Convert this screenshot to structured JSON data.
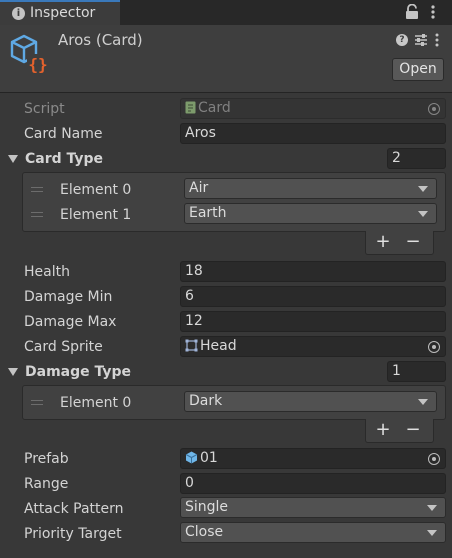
{
  "window": {
    "tab_label": "Inspector",
    "title": "Aros (Card)",
    "open_label": "Open"
  },
  "fields": {
    "script": {
      "label": "Script",
      "value": "Card"
    },
    "card_name": {
      "label": "Card Name",
      "value": "Aros"
    },
    "card_type": {
      "label": "Card Type",
      "count": "2",
      "elements": [
        {
          "label": "Element 0",
          "value": "Air"
        },
        {
          "label": "Element 1",
          "value": "Earth"
        }
      ]
    },
    "health": {
      "label": "Health",
      "value": "18"
    },
    "damage_min": {
      "label": "Damage Min",
      "value": "6"
    },
    "damage_max": {
      "label": "Damage Max",
      "value": "12"
    },
    "card_sprite": {
      "label": "Card Sprite",
      "value": "Head"
    },
    "damage_type": {
      "label": "Damage Type",
      "count": "1",
      "elements": [
        {
          "label": "Element 0",
          "value": "Dark"
        }
      ]
    },
    "prefab": {
      "label": "Prefab",
      "value": "01"
    },
    "range": {
      "label": "Range",
      "value": "0"
    },
    "attack_pattern": {
      "label": "Attack Pattern",
      "value": "Single"
    },
    "priority_target": {
      "label": "Priority Target",
      "value": "Close"
    }
  },
  "list_controls": {
    "add": "+",
    "remove": "−"
  },
  "colors": {
    "accent": "#3a79bb",
    "background": "#383838",
    "field": "#2a2a2a",
    "dropdown": "#515151",
    "script_icon_blue": "#5fa9e4",
    "script_icon_orange": "#e4622d"
  }
}
